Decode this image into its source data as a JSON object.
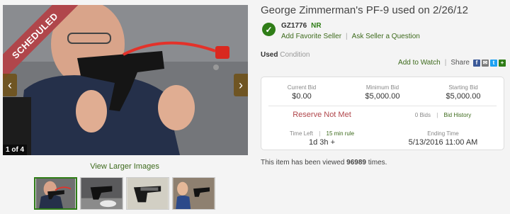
{
  "gallery": {
    "ribbon": "SCHEDULED",
    "counter": "1 of 4",
    "view_larger": "View Larger Images",
    "thumbnails": [
      "officer-holding-pistol",
      "pistol-on-table",
      "pistol-side-view",
      "woman-holding-pistol"
    ]
  },
  "listing": {
    "title": "George Zimmerman's PF-9 used on 2/26/12",
    "condition_value": "Used",
    "condition_label": "Condition",
    "views_prefix": "This item has been viewed ",
    "views_count": "96989",
    "views_suffix": " times."
  },
  "seller": {
    "id": "GZ1776",
    "rating": "NR",
    "add_favorite": "Add Favorite Seller",
    "ask_question": "Ask Seller a Question"
  },
  "actions": {
    "watch": "Add to Watch",
    "share": "Share",
    "share_icons": [
      "facebook-icon",
      "email-icon",
      "twitter-icon",
      "plus-icon"
    ]
  },
  "bid": {
    "current_label": "Current Bid",
    "current_value": "$0.00",
    "minimum_label": "Minimum Bid",
    "minimum_value": "$5,000.00",
    "starting_label": "Starting Bid",
    "starting_value": "$5,000.00",
    "reserve": "Reserve Not Met",
    "bids_count": "0 Bids",
    "bid_history": "Bid History",
    "time_left_label": "Time Left",
    "time_rule": "15 min rule",
    "time_left_value": "1d 3h +",
    "ending_label": "Ending Time",
    "ending_value": "5/13/2016 11:00 AM"
  },
  "colors": {
    "accent_green": "#2f7d17",
    "link_green": "#3d6a1c",
    "reserve_red": "#b0464b",
    "ribbon": "#b0464b"
  }
}
